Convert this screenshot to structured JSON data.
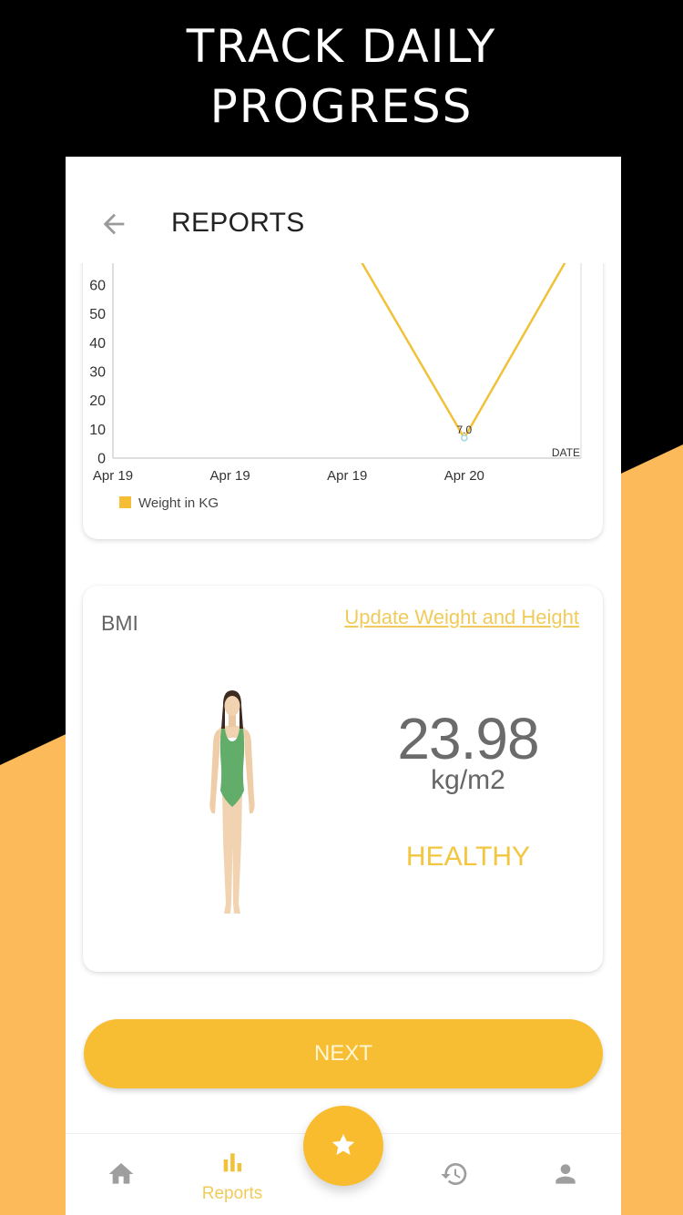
{
  "promo": {
    "headline_line1": "TRACK DAILY",
    "headline_line2": "PROGRESS"
  },
  "colors": {
    "background_dark": "#000000",
    "background_accent": "#FDBA5B",
    "primary_yellow": "#F8BE33",
    "link_yellow": "#F0CB5C",
    "status_healthy": "#F3C640",
    "icon_grey": "#9E9E9E",
    "text_dark": "#222222"
  },
  "header": {
    "back_icon": "arrow-left-icon",
    "title": "REPORTS"
  },
  "chart_data": {
    "type": "line",
    "title": "",
    "xlabel": "DATE",
    "ylabel": "",
    "x_tick_labels": [
      "Apr 19",
      "Apr 19",
      "Apr 19",
      "Apr 20"
    ],
    "y_ticks": [
      0,
      10,
      20,
      30,
      40,
      50,
      60
    ],
    "ylim": [
      0,
      67
    ],
    "grid": false,
    "legend": {
      "position": "bottom-left",
      "entries": [
        {
          "label": "Weight in KG",
          "color": "#F5BE35"
        }
      ]
    },
    "series": [
      {
        "name": "Weight in KG",
        "color": "#F2C13A",
        "points": [
          {
            "x": 2,
            "y": 76.5
          },
          {
            "x": 3,
            "y": 7.0
          },
          {
            "x": 4,
            "y": 77.7
          }
        ]
      }
    ],
    "data_labels": [
      {
        "x": 3,
        "y": 7.0,
        "text": "7.0"
      }
    ]
  },
  "bmi": {
    "title": "BMI",
    "update_link": "Update Weight and Height",
    "value": "23.98",
    "unit": "kg/m2",
    "status": "HEALTHY",
    "figure": "woman-body-illustration"
  },
  "next_button": {
    "label": "NEXT"
  },
  "bottom_nav": {
    "items": [
      {
        "icon": "home-icon",
        "label": "",
        "active": false
      },
      {
        "icon": "bar-chart-icon",
        "label": "Reports",
        "active": true
      },
      {
        "icon": "star-icon",
        "label": "",
        "active": false
      },
      {
        "icon": "history-icon",
        "label": "",
        "active": false
      },
      {
        "icon": "person-icon",
        "label": "",
        "active": false
      }
    ]
  }
}
